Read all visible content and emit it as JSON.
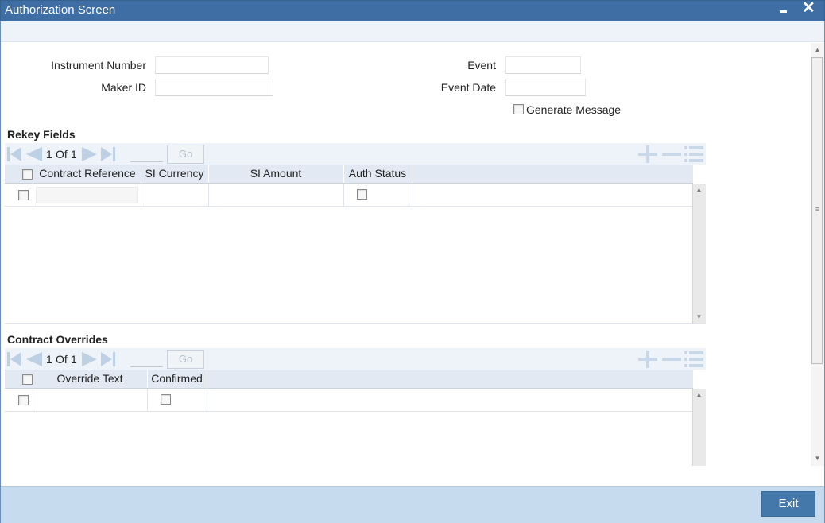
{
  "window": {
    "title": "Authorization Screen",
    "minimize_label": "−",
    "close_label": "✕"
  },
  "form": {
    "instrument_number_label": "Instrument Number",
    "instrument_number_value": "",
    "maker_id_label": "Maker ID",
    "maker_id_value": "",
    "event_label": "Event",
    "event_value": "",
    "event_date_label": "Event Date",
    "event_date_value": "",
    "generate_message_label": "Generate Message",
    "generate_message_checked": false
  },
  "rekey": {
    "title": "Rekey Fields",
    "pager": {
      "current": "1",
      "of_label": "Of",
      "total": "1"
    },
    "go_label": "Go",
    "columns": [
      "Contract Reference",
      "SI Currency",
      "SI Amount",
      "Auth Status"
    ]
  },
  "overrides": {
    "title": "Contract Overrides",
    "pager": {
      "current": "1",
      "of_label": "Of",
      "total": "1"
    },
    "go_label": "Go",
    "columns": [
      "Override Text",
      "Confirmed"
    ]
  },
  "footer": {
    "exit_label": "Exit"
  },
  "colors": {
    "titlebar": "#3f6ea5",
    "footer": "#c6dbee",
    "exit_button": "#4478aa",
    "grid_header": "#e2e9f2"
  }
}
